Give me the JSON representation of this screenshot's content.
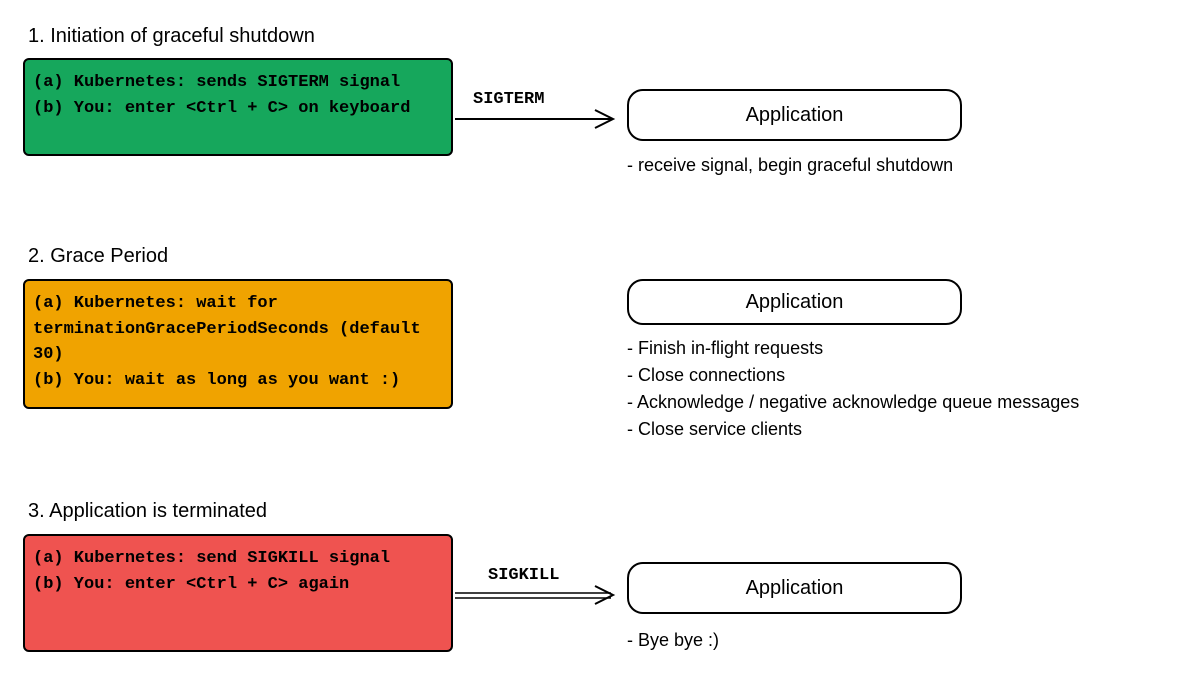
{
  "sections": [
    {
      "title": "1. Initiation of graceful shutdown",
      "box_color": "green",
      "lines": [
        "(a) Kubernetes: sends SIGTERM signal",
        "",
        "(b) You: enter <Ctrl + C> on keyboard"
      ],
      "arrow_label": "SIGTERM",
      "app_label": "Application",
      "notes": [
        "- receive signal, begin graceful shutdown"
      ]
    },
    {
      "title": "2. Grace Period",
      "box_color": "orange",
      "lines": [
        "(a) Kubernetes: wait for",
        "terminationGracePeriodSeconds (default 30)",
        "",
        "(b) You: wait as long as you want :)"
      ],
      "arrow_label": "",
      "app_label": "Application",
      "notes": [
        "- Finish in-flight requests",
        "- Close connections",
        "- Acknowledge / negative acknowledge queue messages",
        "- Close service clients"
      ]
    },
    {
      "title": "3. Application is terminated",
      "box_color": "red",
      "lines": [
        "(a) Kubernetes: send SIGKILL signal",
        "",
        "(b) You: enter <Ctrl + C> again"
      ],
      "arrow_label": "SIGKILL",
      "app_label": "Application",
      "notes": [
        "- Bye bye :)"
      ]
    }
  ]
}
